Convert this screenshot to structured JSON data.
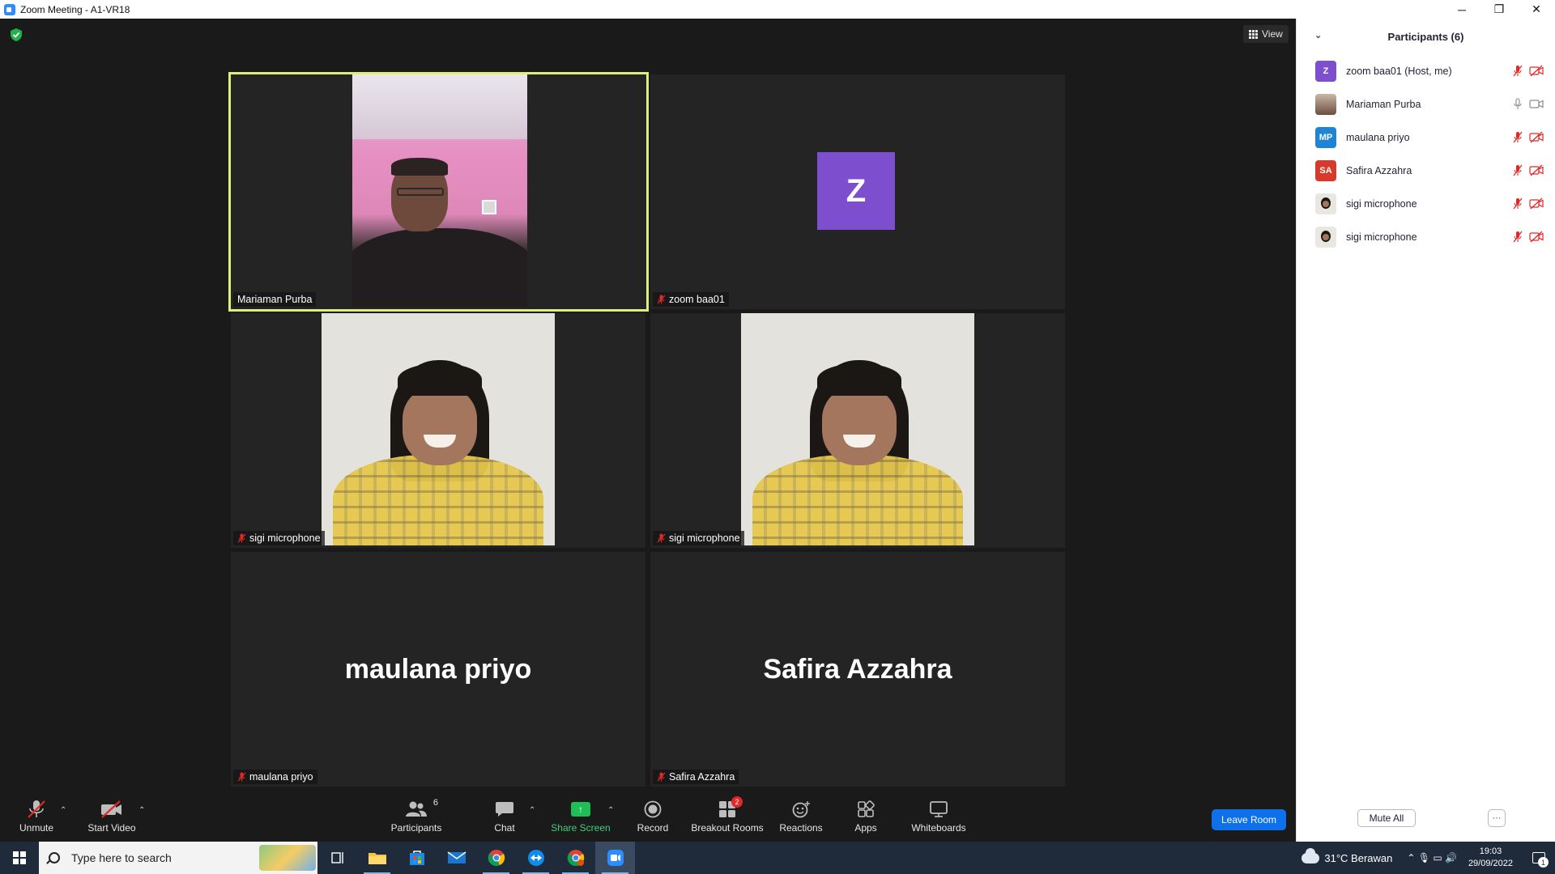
{
  "window": {
    "title": "Zoom Meeting - A1-VR18",
    "minimize": "─",
    "restore": "❐",
    "close": "✕"
  },
  "meeting": {
    "view_label": "View",
    "tiles": [
      {
        "name": "Mariaman Purba",
        "muted": false,
        "active": true
      },
      {
        "name": "zoom baa01",
        "muted": true,
        "avatar_letter": "Z",
        "avatar_color": "#7d4fcf"
      },
      {
        "name": "sigi microphone",
        "muted": true
      },
      {
        "name": "sigi microphone",
        "muted": true
      },
      {
        "name": "maulana priyo",
        "muted": true,
        "big_name": "maulana priyo"
      },
      {
        "name": "Safira Azzahra",
        "muted": true,
        "big_name": "Safira Azzahra"
      }
    ]
  },
  "toolbar": {
    "unmute": "Unmute",
    "start_video": "Start Video",
    "participants": "Participants",
    "participants_count": "6",
    "chat": "Chat",
    "share_screen": "Share Screen",
    "record": "Record",
    "breakout_rooms": "Breakout Rooms",
    "breakout_badge": "2",
    "reactions": "Reactions",
    "apps": "Apps",
    "whiteboards": "Whiteboards",
    "leave_room": "Leave Room"
  },
  "panel": {
    "title": "Participants (6)",
    "participants": [
      {
        "name": "zoom baa01 (Host, me)",
        "initials": "Z",
        "color": "#7d4fcf",
        "mic": "muted",
        "video": "off"
      },
      {
        "name": "Mariaman Purba",
        "avatar": "photo",
        "mic": "on",
        "video": "on"
      },
      {
        "name": "maulana priyo",
        "initials": "MP",
        "color": "#1f84d6",
        "mic": "muted",
        "video": "off"
      },
      {
        "name": "Safira Azzahra",
        "initials": "SA",
        "color": "#d63a2c",
        "mic": "muted",
        "video": "off"
      },
      {
        "name": "sigi microphone",
        "avatar": "kid",
        "mic": "muted",
        "video": "off"
      },
      {
        "name": "sigi microphone",
        "avatar": "kid",
        "mic": "muted",
        "video": "off"
      }
    ],
    "mute_all": "Mute All",
    "more": "···"
  },
  "taskbar": {
    "search_placeholder": "Type here to search",
    "weather": "31°C  Berawan",
    "time": "19:03",
    "date": "29/09/2022",
    "notification_count": "1",
    "tray_icons": "⌃  🎙  ▭  🔊"
  }
}
